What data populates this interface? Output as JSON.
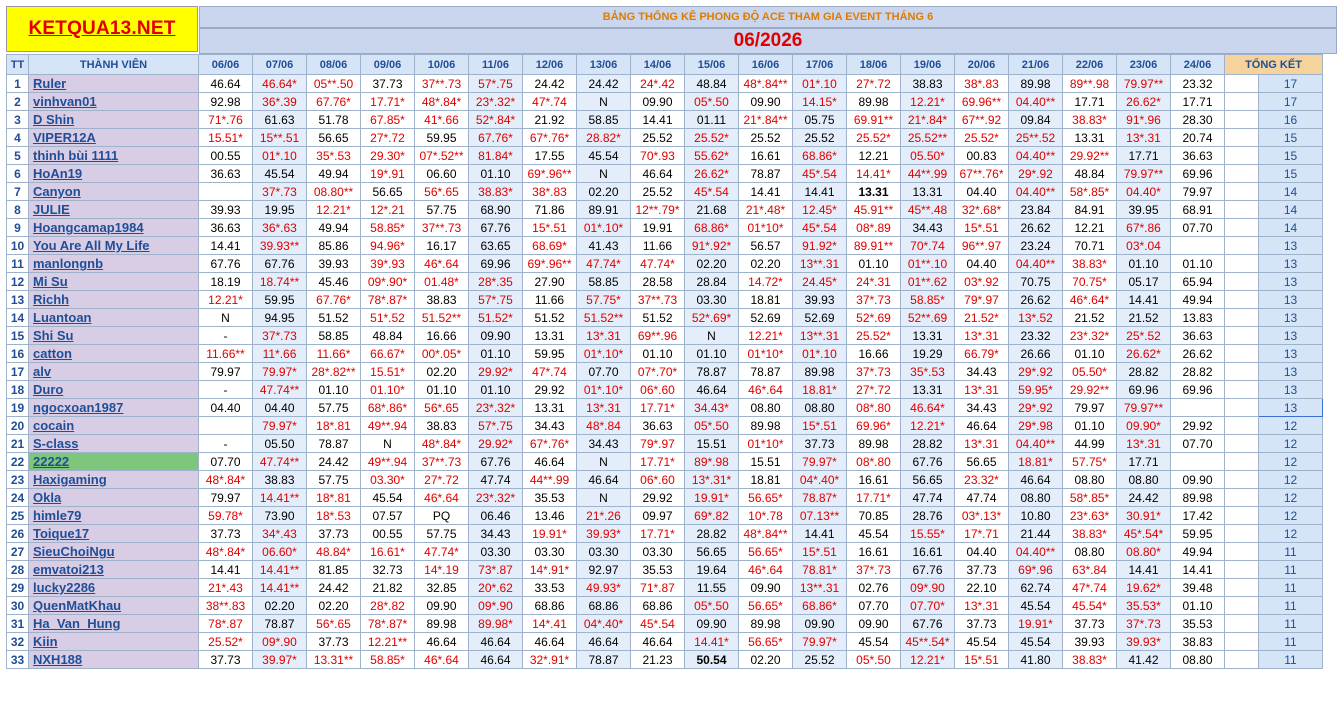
{
  "site_logo": "KETQUA13.NET",
  "title": "BẢNG THỐNG KÊ PHONG ĐỘ ACE THAM GIA EVENT THÁNG 6",
  "month": "06/2026",
  "headers": {
    "tt": "TT",
    "member": "THÀNH VIÊN",
    "dates": [
      "06/06",
      "07/06",
      "08/06",
      "09/06",
      "10/06",
      "11/06",
      "12/06",
      "13/06",
      "14/06",
      "15/06",
      "16/06",
      "17/06",
      "18/06",
      "19/06",
      "20/06",
      "21/06",
      "22/06",
      "23/06",
      "24/06"
    ],
    "total": "TỔNG KẾT"
  },
  "colors": {
    "red_value": "#e00000",
    "name_bg": "#d9cde6",
    "highlight_bg": "#7dc67c",
    "header_text": "#1f4e96"
  },
  "rows": [
    {
      "stt": "1",
      "name": "Ruler",
      "vals": [
        "46.64",
        "46.64*",
        "05**.50",
        "37.73",
        "37**.73",
        "57*.75",
        "24.42",
        "24.42",
        "24*.42",
        "48.84",
        "48*.84**",
        "01*.10",
        "27*.72",
        "38.83",
        "38*.83",
        "89.98",
        "89**.98",
        "79.97**",
        "23.32"
      ],
      "total": "17"
    },
    {
      "stt": "2",
      "name": "vinhvan01",
      "vals": [
        "92.98",
        "36*.39",
        "67.76*",
        "17.71*",
        "48*.84*",
        "23*.32*",
        "47*.74",
        "N",
        "09.90",
        "05*.50",
        "09.90",
        "14.15*",
        "89.98",
        "12.21*",
        "69.96**",
        "04.40**",
        "17.71",
        "26.62*",
        "17.71"
      ],
      "total": "17"
    },
    {
      "stt": "3",
      "name": "D Shin",
      "vals": [
        "71*.76",
        "61.63",
        "51.78",
        "67.85*",
        "41*.66",
        "52*.84*",
        "21.92",
        "58.85",
        "14.41",
        "01.11",
        "21*.84**",
        "05.75",
        "69.91**",
        "21*.84*",
        "67**.92",
        "09.84",
        "38.83*",
        "91*.96",
        "28.30"
      ],
      "total": "16"
    },
    {
      "stt": "4",
      "name": "VIPER12A",
      "vals": [
        "15.51*",
        "15**.51",
        "56.65",
        "27*.72",
        "59.95",
        "67.76*",
        "67*.76*",
        "28.82*",
        "25.52",
        "25.52*",
        "25.52",
        "25.52",
        "25.52*",
        "25.52**",
        "25.52*",
        "25**.52",
        "13.31",
        "13*.31",
        "20.74"
      ],
      "total": "15"
    },
    {
      "stt": "5",
      "name": "thinh bùi 1111",
      "vals": [
        "00.55",
        "01*.10",
        "35*.53",
        "29.30*",
        "07*.52**",
        "81.84*",
        "17.55",
        "45.54",
        "70*.93",
        "55.62*",
        "16.61",
        "68.86*",
        "12.21",
        "05.50*",
        "00.83",
        "04.40**",
        "29.92**",
        "17.71",
        "36.63"
      ],
      "total": "15"
    },
    {
      "stt": "6",
      "name": "HoAn19",
      "vals": [
        "36.63",
        "45.54",
        "49.94",
        "19*.91",
        "06.60",
        "01.10",
        "69*.96**",
        "N",
        "46.64",
        "26.62*",
        "78.87",
        "45*.54",
        "14.41*",
        "44**.99",
        "67**.76*",
        "29*.92",
        "48.84",
        "79.97**",
        "69.96"
      ],
      "total": "15"
    },
    {
      "stt": "7",
      "name": "Canyon",
      "vals": [
        "",
        "37*.73",
        "08.80**",
        "56.65",
        "56*.65",
        "38.83*",
        "38*.83",
        "02.20",
        "25.52",
        "45*.54",
        "14.41",
        "14.41",
        "13.31",
        "13.31",
        "04.40",
        "04.40**",
        "58*.85*",
        "04.40*",
        "79.97"
      ],
      "total": "14"
    },
    {
      "stt": "8",
      "name": "JULIE",
      "vals": [
        "39.93",
        "19.95",
        "12.21*",
        "12*.21",
        "57.75",
        "68.90",
        "71.86",
        "89.91",
        "12**.79*",
        "21.68",
        "21*.48*",
        "12.45*",
        "45.91**",
        "45**.48",
        "32*.68*",
        "23.84",
        "84.91",
        "39.95",
        "68.91"
      ],
      "total": "14"
    },
    {
      "stt": "9",
      "name": "Hoangcamap1984",
      "vals": [
        "36.63",
        "36*.63",
        "49.94",
        "58.85*",
        "37**.73",
        "67.76",
        "15*.51",
        "01*.10*",
        "19.91",
        "68.86*",
        "01*10*",
        "45*.54",
        "08*.89",
        "34.43",
        "15*.51",
        "26.62",
        "12.21",
        "67*.86",
        "07.70"
      ],
      "total": "14"
    },
    {
      "stt": "10",
      "name": "You Are All My Life",
      "vals": [
        "14.41",
        "39.93**",
        "85.86",
        "94.96*",
        "16.17",
        "63.65",
        "68.69*",
        "41.43",
        "11.66",
        "91*.92*",
        "56.57",
        "91.92*",
        "89.91**",
        "70*.74",
        "96**.97",
        "23.24",
        "70.71",
        "03*.04",
        ""
      ],
      "total": "13"
    },
    {
      "stt": "11",
      "name": "manlongnb",
      "vals": [
        "67.76",
        "67.76",
        "39.93",
        "39*.93",
        "46*.64",
        "69.96",
        "69*.96**",
        "47.74*",
        "47.74*",
        "02.20",
        "02.20",
        "13**.31",
        "01.10",
        "01**.10",
        "04.40",
        "04.40**",
        "38.83*",
        "01.10",
        "01.10"
      ],
      "total": "13"
    },
    {
      "stt": "12",
      "name": "Mi Su",
      "vals": [
        "18.19",
        "18.74**",
        "45.46",
        "09*.90*",
        "01.48*",
        "28*.35",
        "27.90",
        "58.85",
        "28.58",
        "28.84",
        "14.72*",
        "24.45*",
        "24*.31",
        "01**.62",
        "03*.92",
        "70.75",
        "70.75*",
        "05.17",
        "65.94"
      ],
      "total": "13"
    },
    {
      "stt": "13",
      "name": "Richh",
      "vals": [
        "12.21*",
        "59.95",
        "67.76*",
        "78*.87*",
        "38.83",
        "57*.75",
        "11.66",
        "57.75*",
        "37**.73",
        "03.30",
        "18.81",
        "39.93",
        "37*.73",
        "58.85*",
        "79*.97",
        "26.62",
        "46*.64*",
        "14.41",
        "49.94"
      ],
      "total": "13"
    },
    {
      "stt": "14",
      "name": "Luantoan",
      "vals": [
        "N",
        "94.95",
        "51.52",
        "51*.52",
        "51.52**",
        "51.52*",
        "51.52",
        "51.52**",
        "51.52",
        "52*.69*",
        "52.69",
        "52.69",
        "52*.69",
        "52**.69",
        "21.52*",
        "13*.52",
        "21.52",
        "21.52",
        "13.83"
      ],
      "total": "13"
    },
    {
      "stt": "15",
      "name": "Shi Su",
      "vals": [
        "-",
        "37*.73",
        "58.85",
        "48.84",
        "16.66",
        "09.90",
        "13.31",
        "13*.31",
        "69**.96",
        "N",
        "12.21*",
        "13**.31",
        "25.52*",
        "13.31",
        "13*.31",
        "23.32",
        "23*.32*",
        "25*.52",
        "36.63"
      ],
      "total": "13"
    },
    {
      "stt": "16",
      "name": "catton",
      "vals": [
        "11.66**",
        "11*.66",
        "11.66*",
        "66.67*",
        "00*.05*",
        "01.10",
        "59.95",
        "01*.10*",
        "01.10",
        "01.10",
        "01*10*",
        "01*.10",
        "16.66",
        "19.29",
        "66.79*",
        "26.66",
        "01.10",
        "26.62*",
        "26.62"
      ],
      "total": "13"
    },
    {
      "stt": "17",
      "name": "alv",
      "vals": [
        "79.97",
        "79.97*",
        "28*.82**",
        "15.51*",
        "02.20",
        "29.92*",
        "47*.74",
        "07.70",
        "07*.70*",
        "78.87",
        "78.87",
        "89.98",
        "37*.73",
        "35*.53",
        "34.43",
        "29*.92",
        "05.50*",
        "28.82",
        "28.82"
      ],
      "total": "13"
    },
    {
      "stt": "18",
      "name": "Duro",
      "vals": [
        "-",
        "47.74**",
        "01.10",
        "01.10*",
        "01.10",
        "01.10",
        "29.92",
        "01*.10*",
        "06*.60",
        "46.64",
        "46*.64",
        "18.81*",
        "27*.72",
        "13.31",
        "13*.31",
        "59.95*",
        "29.92**",
        "69.96",
        "69.96"
      ],
      "total": "13"
    },
    {
      "stt": "19",
      "name": "ngocxoan1987",
      "vals": [
        "04.40",
        "04.40",
        "57.75",
        "68*.86*",
        "56*.65",
        "23*.32*",
        "13.31",
        "13*.31",
        "17.71*",
        "34.43*",
        "08.80",
        "08.80",
        "08*.80",
        "46.64*",
        "34.43",
        "29*.92",
        "79.97",
        "79.97**",
        ""
      ],
      "total": "13"
    },
    {
      "stt": "20",
      "name": "cocain",
      "vals": [
        "",
        "79.97*",
        "18*.81",
        "49**.94",
        "38.83",
        "57*.75",
        "34.43",
        "48*.84",
        "36.63",
        "05*.50",
        "89.98",
        "15*.51",
        "69.96*",
        "12.21*",
        "46.64",
        "29*.98",
        "01.10",
        "09.90*",
        "29.92"
      ],
      "total": "12"
    },
    {
      "stt": "21",
      "name": "S-class",
      "vals": [
        "-",
        "05.50",
        "78.87",
        "N",
        "48*.84*",
        "29.92*",
        "67*.76*",
        "34.43",
        "79*.97",
        "15.51",
        "01*10*",
        "37.73",
        "89.98",
        "28.82",
        "13*.31",
        "04.40**",
        "44.99",
        "13*.31",
        "07.70"
      ],
      "total": "12"
    },
    {
      "stt": "22",
      "name": "22222",
      "vals": [
        "07.70",
        "47.74**",
        "24.42",
        "49**.94",
        "37**.73",
        "67.76",
        "46.64",
        "N",
        "17.71*",
        "89*.98",
        "15.51",
        "79.97*",
        "08*.80",
        "67.76",
        "56.65",
        "18.81*",
        "57.75*",
        "17.71",
        ""
      ],
      "total": "12"
    },
    {
      "stt": "23",
      "name": "Haxigaming",
      "vals": [
        "48*.84*",
        "38.83",
        "57.75",
        "03.30*",
        "27*.72",
        "47.74",
        "44**.99",
        "46.64",
        "06*.60",
        "13*.31*",
        "18.81",
        "04*.40*",
        "16.61",
        "56.65",
        "23.32*",
        "46.64",
        "08.80",
        "08.80",
        "09.90"
      ],
      "total": "12"
    },
    {
      "stt": "24",
      "name": "Okla",
      "vals": [
        "79.97",
        "14.41**",
        "18*.81",
        "45.54",
        "46*.64",
        "23*.32*",
        "35.53",
        "N",
        "29.92",
        "19.91*",
        "56.65*",
        "78.87*",
        "17.71*",
        "47.74",
        "47.74",
        "08.80",
        "58*.85*",
        "24.42",
        "89.98"
      ],
      "total": "12"
    },
    {
      "stt": "25",
      "name": "himle79",
      "vals": [
        "59.78*",
        "73.90",
        "18*.53",
        "07.57",
        "PQ",
        "06.46",
        "13.46",
        "21*.26",
        "09.97",
        "69*.82",
        "10*.78",
        "07.13**",
        "70.85",
        "28.76",
        "03*.13*",
        "10.80",
        "23*.63*",
        "30.91*",
        "17.42"
      ],
      "total": "12"
    },
    {
      "stt": "26",
      "name": "Toique17",
      "vals": [
        "37.73",
        "34*.43",
        "37.73",
        "00.55",
        "57.75",
        "34.43",
        "19.91*",
        "39.93*",
        "17.71*",
        "28.82",
        "48*.84**",
        "14.41",
        "45.54",
        "15.55*",
        "17*.71",
        "21.44",
        "38.83*",
        "45*.54*",
        "59.95"
      ],
      "total": "12"
    },
    {
      "stt": "27",
      "name": "SieuChoiNgu",
      "vals": [
        "48*.84*",
        "06.60*",
        "48.84*",
        "16.61*",
        "47.74*",
        "03.30",
        "03.30",
        "03.30",
        "03.30",
        "56.65",
        "56.65*",
        "15*.51",
        "16.61",
        "16.61",
        "04.40",
        "04.40**",
        "08.80",
        "08.80*",
        "49.94"
      ],
      "total": "11"
    },
    {
      "stt": "28",
      "name": "emvatoi213",
      "vals": [
        "14.41",
        "14.41**",
        "81.85",
        "32.73",
        "14*.19",
        "73*.87",
        "14*.91*",
        "92.97",
        "35.53",
        "19.64",
        "46*.64",
        "78.81*",
        "37*.73",
        "67.76",
        "37.73",
        "69*.96",
        "63*.84",
        "14.41",
        "14.41"
      ],
      "total": "11"
    },
    {
      "stt": "29",
      "name": "lucky2286",
      "vals": [
        "21*.43",
        "14.41**",
        "24.42",
        "21.82",
        "32.85",
        "20*.62",
        "33.53",
        "49.93*",
        "71*.87",
        "11.55",
        "09.90",
        "13**.31",
        "02.76",
        "09*.90",
        "22.10",
        "62.74",
        "47*.74",
        "19.62*",
        "39.48"
      ],
      "total": "11"
    },
    {
      "stt": "30",
      "name": "QuenMatKhau",
      "vals": [
        "38**.83",
        "02.20",
        "02.20",
        "28*.82",
        "09.90",
        "09*.90",
        "68.86",
        "68.86",
        "68.86",
        "05*.50",
        "56.65*",
        "68.86*",
        "07.70",
        "07.70*",
        "13*.31",
        "45.54",
        "45.54*",
        "35.53*",
        "01.10"
      ],
      "total": "11"
    },
    {
      "stt": "31",
      "name": "Ha_Van_Hung",
      "vals": [
        "78*.87",
        "78.87",
        "56*.65",
        "78*.87*",
        "89.98",
        "89.98*",
        "14*.41",
        "04*.40*",
        "45*.54",
        "09.90",
        "89.98",
        "09.90",
        "09.90",
        "67.76",
        "37.73",
        "19.91*",
        "37.73",
        "37*.73",
        "35.53"
      ],
      "total": "11"
    },
    {
      "stt": "32",
      "name": "Kiin",
      "vals": [
        "25.52*",
        "09*.90",
        "37.73",
        "12.21**",
        "46.64",
        "46.64",
        "46.64",
        "46.64",
        "46.64",
        "14.41*",
        "56.65*",
        "79.97*",
        "45.54",
        "45**.54*",
        "45.54",
        "45.54",
        "39.93",
        "39.93*",
        "38.83"
      ],
      "total": "11"
    },
    {
      "stt": "33",
      "name": "NXH188",
      "vals": [
        "37.73",
        "39.97*",
        "13.31**",
        "58.85*",
        "46*.64",
        "46.64",
        "32*.91*",
        "78.87",
        "21.23",
        "50.54",
        "02.20",
        "25.52",
        "05*.50",
        "12.21*",
        "15*.51",
        "41.80",
        "38.83*",
        "41.42",
        "08.80"
      ],
      "total": "11"
    }
  ]
}
